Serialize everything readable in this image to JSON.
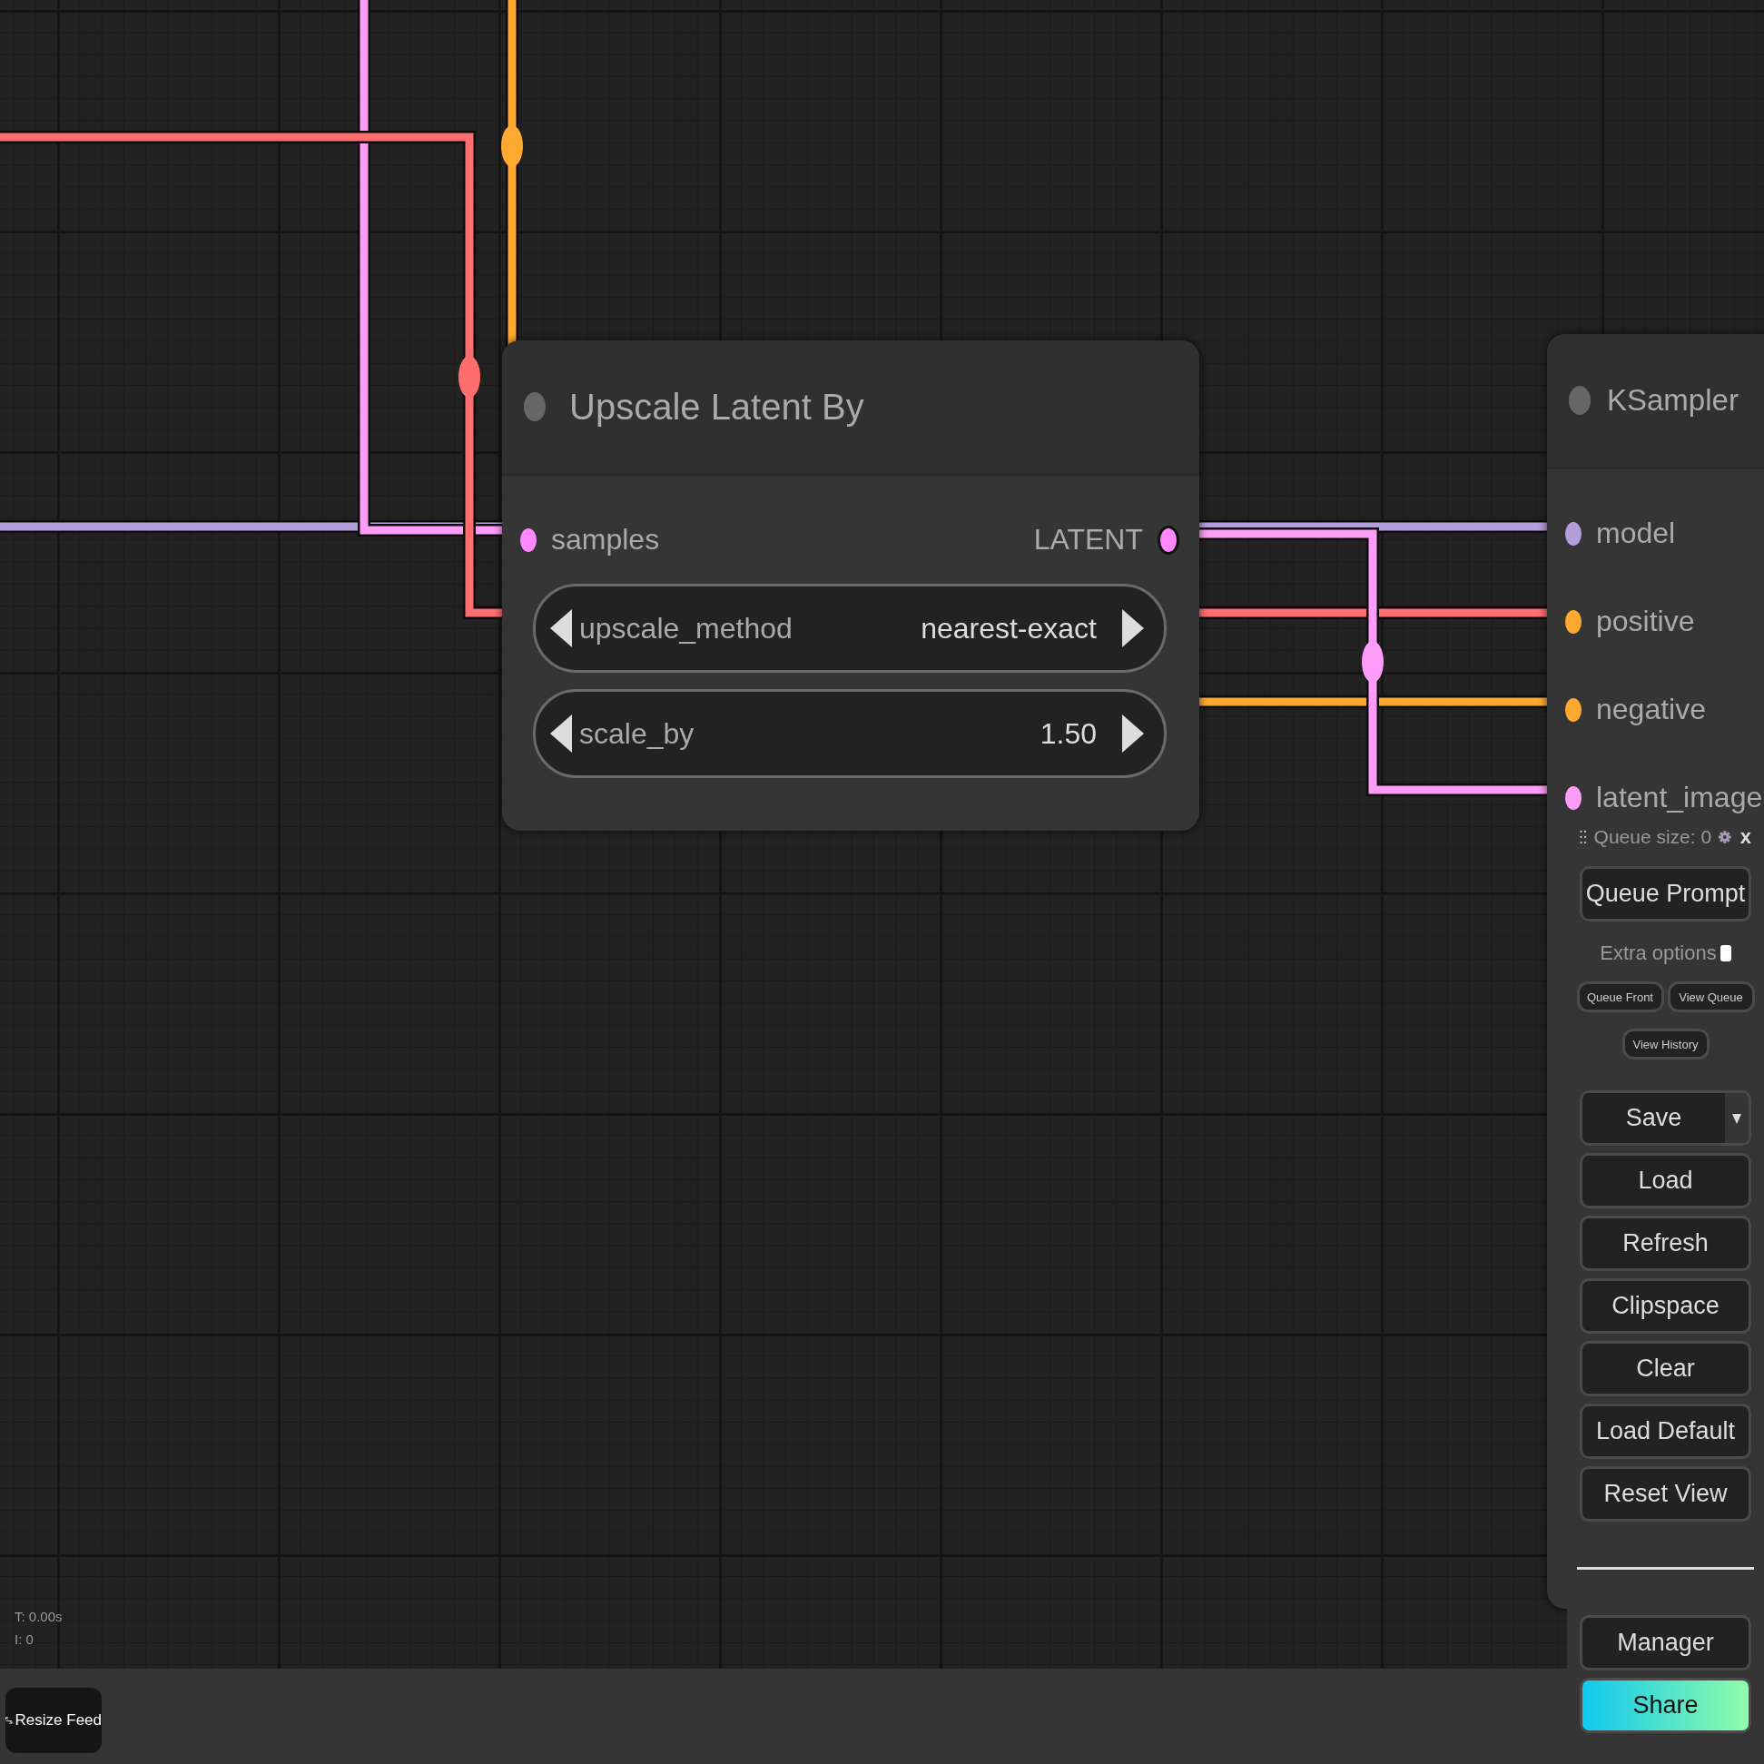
{
  "nodes": [
    {
      "title": "Upscale Latent By",
      "inputs": [
        {
          "label": "samples",
          "color": "#ff88ff"
        }
      ],
      "outputs": [
        {
          "label": "LATENT",
          "color": "#ff88ff"
        }
      ],
      "widgets": [
        {
          "name": "upscale_method",
          "value": "nearest-exact"
        },
        {
          "name": "scale_by",
          "value": "1.50"
        }
      ]
    },
    {
      "title": "KSampler",
      "inputs": [
        {
          "label": "model",
          "color": "#b39ddb"
        },
        {
          "label": "positive",
          "color": "#ffa931"
        },
        {
          "label": "negative",
          "color": "#ffa931"
        },
        {
          "label": "latent_image",
          "color": "#ff9cf9"
        }
      ]
    }
  ],
  "stats": [
    "T: 0.00s",
    "I: 0"
  ],
  "queue_panel": {
    "queue_size": "Queue size: 0",
    "close": "x",
    "queue_button": "Queue Prompt",
    "extra_options": {
      "label": "Extra options",
      "checked": false
    },
    "small_buttons": [
      "Queue Front",
      "View Queue",
      "View History"
    ],
    "buttons": [
      "Save",
      "Load",
      "Refresh",
      "Clipspace",
      "Clear",
      "Load Default",
      "Reset View"
    ],
    "bottom_buttons": [
      {
        "label": "Manager",
        "kind": "plain"
      },
      {
        "label": "Share",
        "kind": "share"
      }
    ]
  },
  "bottom_bar": {
    "resize_button": "Resize Feed"
  }
}
